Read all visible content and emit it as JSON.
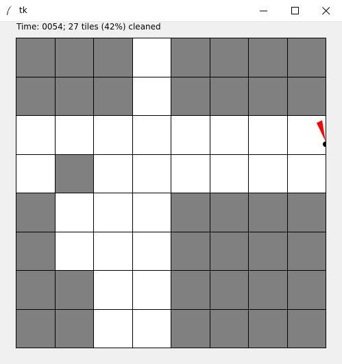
{
  "window": {
    "title": "tk",
    "icon": "feather-icon",
    "controls": [
      "minimize-icon",
      "maximize-icon",
      "close-icon"
    ]
  },
  "status": {
    "text": "Time: 0054; 27 tiles (42%) cleaned"
  },
  "room": {
    "cols": 8,
    "rows": 8,
    "tiles": [
      [
        0,
        0,
        0,
        1,
        0,
        0,
        0,
        0
      ],
      [
        0,
        0,
        0,
        1,
        0,
        0,
        0,
        0
      ],
      [
        1,
        1,
        1,
        1,
        1,
        1,
        1,
        1
      ],
      [
        1,
        0,
        1,
        1,
        1,
        1,
        1,
        1
      ],
      [
        0,
        1,
        1,
        1,
        0,
        0,
        0,
        0
      ],
      [
        0,
        1,
        1,
        1,
        0,
        0,
        0,
        0
      ],
      [
        0,
        0,
        1,
        1,
        0,
        0,
        0,
        0
      ],
      [
        0,
        0,
        1,
        1,
        0,
        0,
        0,
        0
      ]
    ],
    "colors": {
      "dirty": "#808080",
      "clean": "#ffffff",
      "robot_arrow": "#ff0000",
      "robot_body": "#000000"
    }
  },
  "robot": {
    "x": 8.0,
    "y": 2.75
  }
}
